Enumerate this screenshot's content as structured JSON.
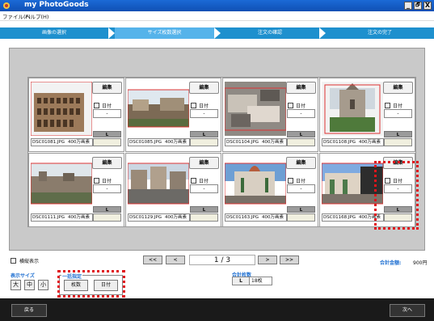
{
  "window": {
    "title": "my PhotoGoods",
    "controls": {
      "minimize": "_",
      "maximize": "🗗",
      "close": "X"
    }
  },
  "menu": {
    "items": [
      {
        "label": "ファイル(F)"
      },
      {
        "label": "ヘルプ(H)"
      }
    ]
  },
  "steps": [
    {
      "label": "画像の選択",
      "state": "done"
    },
    {
      "label": "サイズ枚数選択",
      "state": "current"
    },
    {
      "label": "注文の確認",
      "state": "todo"
    },
    {
      "label": "注文の完了",
      "state": "todo"
    }
  ],
  "photos": [
    {
      "filename": "DSC01081.JPG",
      "resolution": "400万画素",
      "edit_label": "編集",
      "date_label": "日付",
      "date_value": "-",
      "size": "L",
      "scene": "colosseum"
    },
    {
      "filename": "DSC01085.JPG",
      "resolution": "400万画素",
      "edit_label": "編集",
      "date_label": "日付",
      "date_value": "-",
      "size": "L",
      "scene": "forum"
    },
    {
      "filename": "DSC01104.JPG",
      "resolution": "400万画素",
      "edit_label": "編集",
      "date_label": "日付",
      "date_value": "-",
      "size": "L",
      "scene": "ruins"
    },
    {
      "filename": "DSC01108.JPG",
      "resolution": "400万画素",
      "edit_label": "編集",
      "date_label": "日付",
      "date_value": "-",
      "size": "L",
      "scene": "church"
    },
    {
      "filename": "DSC01111.JPG",
      "resolution": "400万画素",
      "edit_label": "編集",
      "date_label": "日付",
      "date_value": "-",
      "size": "L",
      "scene": "overview"
    },
    {
      "filename": "DSC01129.JPG",
      "resolution": "400万画素",
      "edit_label": "編集",
      "date_label": "日付",
      "date_value": "-",
      "size": "L",
      "scene": "square"
    },
    {
      "filename": "DSC01163.JPG",
      "resolution": "400万画素",
      "edit_label": "編集",
      "date_label": "日付",
      "date_value": "-",
      "size": "L",
      "scene": "cathedral"
    },
    {
      "filename": "DSC01168.JPG",
      "resolution": "400万画素",
      "edit_label": "編集",
      "date_label": "日付",
      "date_value": "-",
      "size": "L",
      "scene": "cathedral2"
    }
  ],
  "controls": {
    "detail_view_label": "横縦表示",
    "first_label": "<<",
    "prev_label": "<",
    "page_indicator": "1 / 3",
    "next_label": ">",
    "last_label": ">>",
    "total_label": "合計金額:",
    "total_value": "900円",
    "display_size_label": "表示サイズ",
    "size_large": "大",
    "size_medium": "中",
    "size_small": "小",
    "bulk_label": "一括指定",
    "bulk_count": "枚数",
    "bulk_date": "日付",
    "total_count_label": "合計枚数",
    "total_count_size": "L",
    "total_count_value": "18枚"
  },
  "footer": {
    "back_label": "戻る",
    "next_label": "次へ"
  },
  "colors": {
    "step_bar": "#1e90ce",
    "step_current": "#55b3ea",
    "title_bar": "#1b6ad6",
    "highlight_red": "#e0151b"
  }
}
